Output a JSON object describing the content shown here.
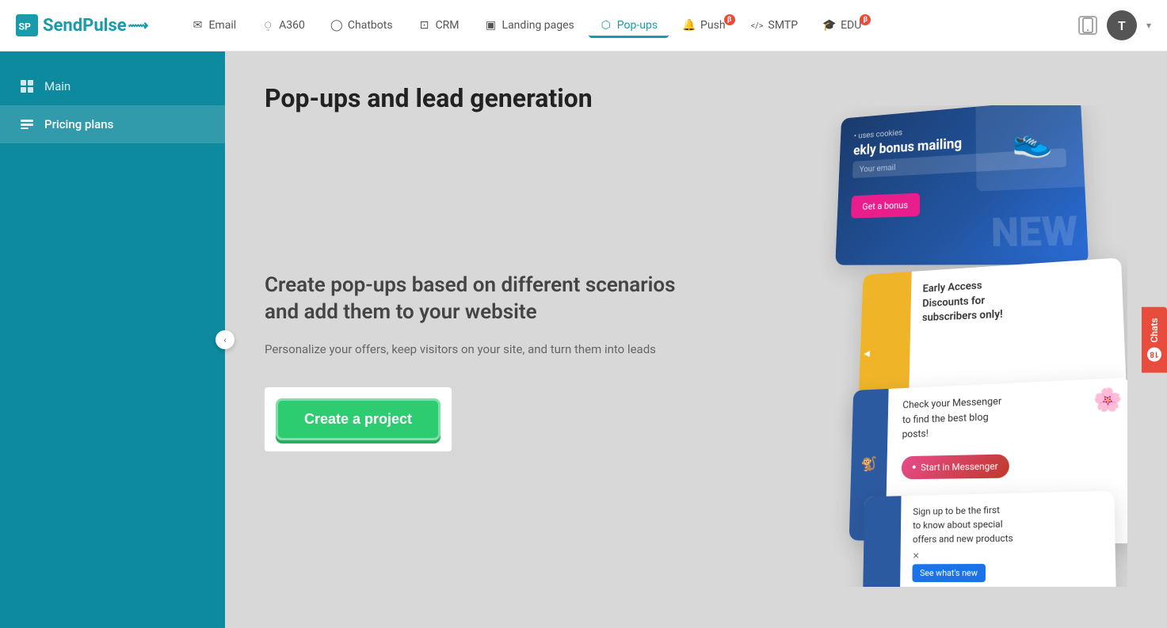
{
  "logo": {
    "text": "SendPulse"
  },
  "nav": {
    "items": [
      {
        "id": "email",
        "label": "Email",
        "icon": "✉",
        "active": false,
        "beta": false
      },
      {
        "id": "a360",
        "label": "A360",
        "icon": "◎",
        "active": false,
        "beta": false
      },
      {
        "id": "chatbots",
        "label": "Chatbots",
        "icon": "💬",
        "active": false,
        "beta": false
      },
      {
        "id": "crm",
        "label": "CRM",
        "icon": "⊞",
        "active": false,
        "beta": false
      },
      {
        "id": "landing-pages",
        "label": "Landing pages",
        "icon": "▣",
        "active": false,
        "beta": false
      },
      {
        "id": "pop-ups",
        "label": "Pop-ups",
        "icon": "⬡",
        "active": true,
        "beta": false
      },
      {
        "id": "push",
        "label": "Push",
        "icon": "🔔",
        "active": false,
        "beta": true
      },
      {
        "id": "smtp",
        "label": "SMTP",
        "icon": "</>",
        "active": false,
        "beta": false
      },
      {
        "id": "edu",
        "label": "EDU",
        "icon": "🎓",
        "active": false,
        "beta": true
      }
    ],
    "avatar_letter": "T",
    "dropdown_arrow": "▾"
  },
  "sidebar": {
    "items": [
      {
        "id": "main",
        "label": "Main",
        "icon": "⊞",
        "active": false
      },
      {
        "id": "pricing-plans",
        "label": "Pricing plans",
        "icon": "▣",
        "active": true
      }
    ],
    "collapse_icon": "‹"
  },
  "content": {
    "page_title": "Pop-ups and lead generation",
    "promo_headline": "Create pop-ups based on different scenarios and add them to your website",
    "promo_subtext": "Personalize your offers, keep visitors on your site, and turn them into leads",
    "create_button": "Create a project"
  },
  "illustration": {
    "card1": {
      "title": "ekly bonus mailing",
      "placeholder": "Your email",
      "button": "Get a bonus",
      "label": "NEW"
    },
    "card2": {
      "text1": "Early Access",
      "text2": "Discounts for",
      "text3": "subscribers only!"
    },
    "card3": {
      "text1": "Check your Messenger",
      "text2": "to find the best blog",
      "text3": "posts!",
      "button": "Start in Messenger"
    },
    "card4": {
      "text1": "Sign up to be the first",
      "text2": "to know about special",
      "text3": "offers and new products",
      "button": "See what's new"
    }
  },
  "chats": {
    "label": "Chats",
    "count": "18"
  }
}
